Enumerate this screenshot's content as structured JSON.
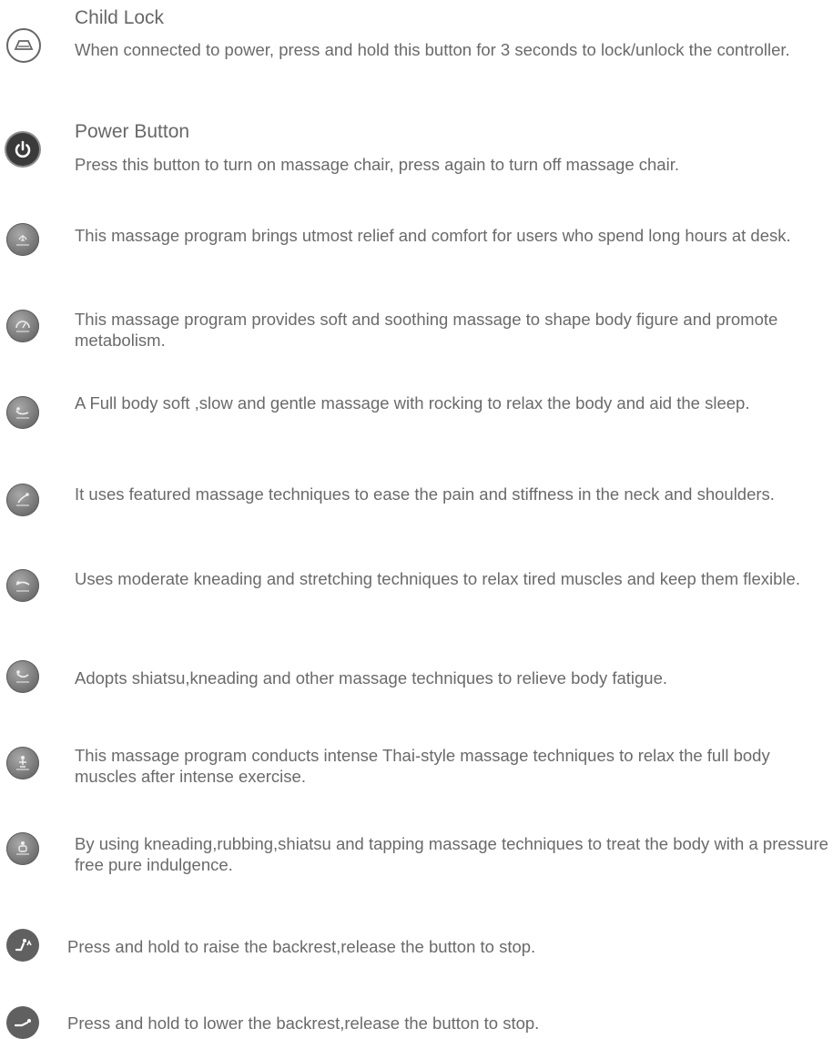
{
  "entries": [
    {
      "icon": "child-lock-icon",
      "title": "Child Lock",
      "desc": "When connected to power, press and hold this button for 3 seconds to lock/unlock the controller."
    },
    {
      "icon": "power-icon",
      "title": "Power Button",
      "desc": "Press this button to turn on massage chair, press again to turn off  massage chair."
    },
    {
      "icon": "desk-relief-program-icon",
      "title": "",
      "desc": "This massage program brings utmost relief and comfort for users who spend long hours at desk."
    },
    {
      "icon": "body-shaping-program-icon",
      "title": "",
      "desc": "This massage program provides soft and soothing massage to shape body figure and promote metabolism."
    },
    {
      "icon": "sleep-program-icon",
      "title": "",
      "desc": "A Full body soft ,slow and gentle massage with rocking to relax the body and aid the sleep."
    },
    {
      "icon": "neck-shoulder-program-icon",
      "title": "",
      "desc": "It uses featured massage techniques to ease the pain and stiffness in the neck and shoulders."
    },
    {
      "icon": "stretch-program-icon",
      "title": "",
      "desc": "Uses moderate kneading and stretching techniques to relax tired muscles and keep them flexible."
    },
    {
      "icon": "fatigue-relief-program-icon",
      "title": "",
      "desc": "Adopts shiatsu,kneading and other massage techniques to relieve body fatigue."
    },
    {
      "icon": "thai-massage-program-icon",
      "title": "",
      "desc": "This massage program conducts intense Thai-style massage techniques to relax the full body muscles after intense exercise."
    },
    {
      "icon": "pressure-free-program-icon",
      "title": "",
      "desc": "By using kneading,rubbing,shiatsu and tapping massage techniques to treat the body with a pressure free pure indulgence."
    },
    {
      "icon": "backrest-up-icon",
      "title": "",
      "desc": "Press and hold to raise the backrest,release the button to stop."
    },
    {
      "icon": "backrest-down-icon",
      "title": "",
      "desc": "Press and hold to lower the backrest,release the button to stop."
    }
  ]
}
